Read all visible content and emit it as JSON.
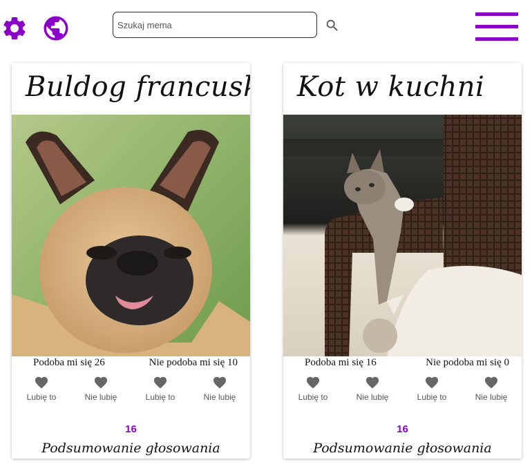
{
  "header": {
    "search_placeholder": "Szukaj mema",
    "settings_icon": "gear-icon",
    "language_icon": "globe-icon",
    "search_icon": "search-icon",
    "menu_icon": "hamburger-menu-icon",
    "accent_color": "#8b00c9"
  },
  "cards": [
    {
      "title": "Buldog francuski",
      "likes_text": "Podoba mi się 26",
      "dislikes_text": "Nie podoba mi się 10",
      "buttons": [
        "Lubię to",
        "Nie lubię",
        "Lubię to",
        "Nie lubię"
      ],
      "summary_count": "16",
      "summary_label": "Podsumowanie głosowania"
    },
    {
      "title": "Kot w kuchni",
      "likes_text": "Podoba mi się 16",
      "dislikes_text": "Nie podoba mi się 0",
      "buttons": [
        "Lubię to",
        "Nie lubię",
        "Lubię to",
        "Nie lubię"
      ],
      "summary_count": "16",
      "summary_label": "Podsumowanie głosowania"
    }
  ]
}
